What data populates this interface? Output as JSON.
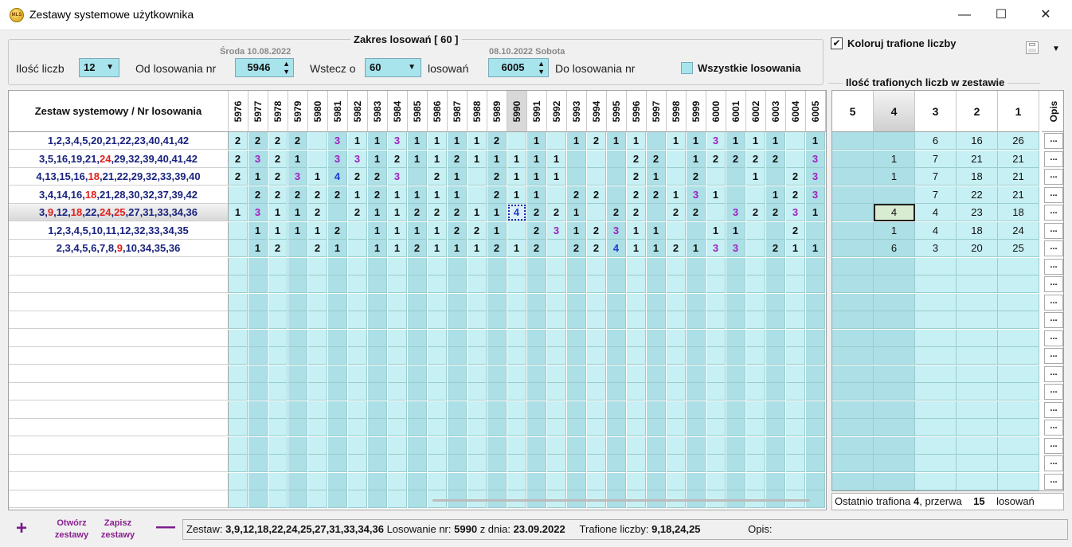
{
  "window": {
    "title": "Zestawy systemowe użytkownika",
    "minimize": "—",
    "maximize": "☐",
    "close": "✕"
  },
  "range": {
    "title": "Zakres losowań  [ 60 ]",
    "count_label": "Ilość liczb",
    "count_value": "12",
    "from_label": "Od losowania nr",
    "from_date": "Środa 10.08.2022",
    "from_value": "5946",
    "back_label": "Wstecz o",
    "back_value": "60",
    "back_unit": "losowań",
    "to_date": "08.10.2022 Sobota",
    "to_value": "6005",
    "to_label": "Do losowania nr",
    "all_label": "Wszystkie losowania"
  },
  "grid": {
    "header": "Zestaw systemowy / Nr losowania",
    "draws": [
      "5976",
      "5977",
      "5978",
      "5979",
      "5980",
      "5981",
      "5982",
      "5983",
      "5984",
      "5985",
      "5986",
      "5987",
      "5988",
      "5989",
      "5990",
      "5991",
      "5992",
      "5993",
      "5994",
      "5995",
      "5996",
      "5997",
      "5998",
      "5999",
      "6000",
      "6001",
      "6002",
      "6003",
      "6004",
      "6005"
    ],
    "rows": [
      {
        "set": "1,2,3,4,5,20,21,22,23,40,41,42",
        "red": [],
        "hits": [
          "2",
          "2",
          "2",
          "2",
          "",
          "3",
          "1",
          "1",
          "3",
          "1",
          "1",
          "1",
          "1",
          "2",
          "",
          "1",
          "",
          "1",
          "2",
          "1",
          "1",
          "",
          "1",
          "1",
          "3",
          "1",
          "1",
          "1",
          "",
          "1"
        ]
      },
      {
        "set": "3,5,16,19,21,24,29,32,39,40,41,42",
        "red": [
          "24"
        ],
        "hits": [
          "2",
          "3",
          "2",
          "1",
          "",
          "3",
          "3",
          "1",
          "2",
          "1",
          "1",
          "2",
          "1",
          "1",
          "1",
          "1",
          "1",
          "",
          "",
          "",
          "2",
          "2",
          "",
          "1",
          "2",
          "2",
          "2",
          "2",
          "",
          "3"
        ]
      },
      {
        "set": "4,13,15,16,18,21,22,29,32,33,39,40",
        "red": [
          "18"
        ],
        "hits": [
          "2",
          "1",
          "2",
          "3",
          "1",
          "4",
          "2",
          "2",
          "3",
          "",
          "2",
          "1",
          "",
          "2",
          "1",
          "1",
          "1",
          "",
          "",
          "",
          "2",
          "1",
          "",
          "2",
          "",
          "",
          "1",
          "",
          "2",
          "3"
        ]
      },
      {
        "set": "3,4,14,16,18,21,28,30,32,37,39,42",
        "red": [
          "18"
        ],
        "hits": [
          "",
          "2",
          "2",
          "2",
          "2",
          "2",
          "1",
          "2",
          "1",
          "1",
          "1",
          "1",
          "",
          "2",
          "1",
          "1",
          "",
          "2",
          "2",
          "",
          "2",
          "2",
          "1",
          "3",
          "1",
          "",
          "",
          "1",
          "2",
          "3"
        ]
      },
      {
        "set": "3,9,12,18,22,24,25,27,31,33,34,36",
        "red": [
          "9",
          "18",
          "24",
          "25"
        ],
        "hits": [
          "1",
          "3",
          "1",
          "1",
          "2",
          "",
          "2",
          "1",
          "1",
          "2",
          "2",
          "2",
          "1",
          "1",
          "4",
          "2",
          "2",
          "1",
          "",
          "2",
          "2",
          "",
          "2",
          "2",
          "",
          "3",
          "2",
          "2",
          "3",
          "1"
        ]
      },
      {
        "set": "1,2,3,4,5,10,11,12,32,33,34,35",
        "red": [],
        "hits": [
          "",
          "1",
          "1",
          "1",
          "1",
          "2",
          "",
          "1",
          "1",
          "1",
          "1",
          "2",
          "2",
          "1",
          "",
          "2",
          "3",
          "1",
          "2",
          "3",
          "1",
          "1",
          "",
          "",
          "1",
          "1",
          "",
          "",
          "2",
          ""
        ]
      },
      {
        "set": "2,3,4,5,6,7,8,9,10,34,35,36",
        "red": [
          "9"
        ],
        "hits": [
          "",
          "1",
          "2",
          "",
          "2",
          "1",
          "",
          "1",
          "1",
          "2",
          "1",
          "1",
          "1",
          "2",
          "1",
          "2",
          "",
          "2",
          "2",
          "4",
          "1",
          "1",
          "2",
          "1",
          "3",
          "3",
          "",
          "2",
          "1",
          "1"
        ]
      }
    ]
  },
  "right": {
    "color_label": "Koloruj trafione liczby",
    "group_title": "Ilość trafionych liczb w zestawie",
    "cols": [
      "5",
      "4",
      "3",
      "2",
      "1"
    ],
    "opis": "Opis",
    "rows": [
      [
        "",
        "",
        "6",
        "16",
        "26"
      ],
      [
        "",
        "1",
        "7",
        "21",
        "21"
      ],
      [
        "",
        "1",
        "7",
        "18",
        "21"
      ],
      [
        "",
        "",
        "7",
        "22",
        "21"
      ],
      [
        "",
        "4",
        "4",
        "23",
        "18"
      ],
      [
        "",
        "1",
        "4",
        "18",
        "24"
      ],
      [
        "",
        "6",
        "3",
        "20",
        "25"
      ]
    ],
    "last_hit_prefix": "Ostatnio trafiona",
    "last_hit_value": "4",
    "last_hit_gap_label": ", przerwa",
    "last_hit_gap": "15",
    "last_hit_unit": "losowań"
  },
  "bottom": {
    "add": "+",
    "remove": "—",
    "open": "Otwórz zestawy",
    "save": "Zapisz zestawy",
    "status_set_label": "Zestaw:",
    "status_set": "3,9,12,18,22,24,25,27,31,33,34,36",
    "status_draw_label": "Losowanie nr:",
    "status_draw": "5990",
    "status_date_label": "z dnia:",
    "status_date": "23.09.2022",
    "status_hit_label": "Trafione liczby:",
    "status_hit": "9,18,24,25",
    "status_opis": "Opis:"
  },
  "colors": {
    "hit1_2": "#111111",
    "hit3": "#a020c0",
    "hit4": "#1a3fd0",
    "cell": "#c7f0f4",
    "cell_alt": "#acdfe6",
    "red": "#e0201c",
    "set_text": "#1a237e"
  }
}
